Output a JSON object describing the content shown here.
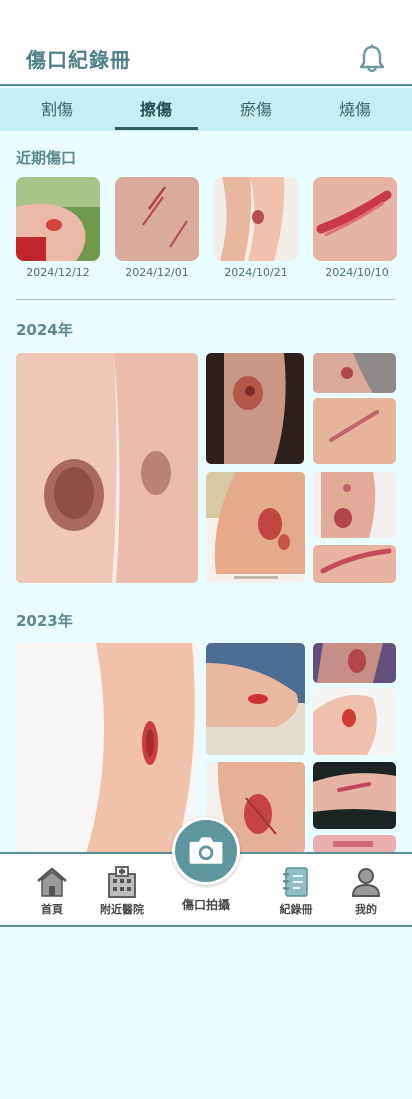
{
  "header": {
    "title": "傷口紀錄冊",
    "bell_icon": "bell-icon"
  },
  "tabs": [
    {
      "label": "割傷",
      "active": false
    },
    {
      "label": "擦傷",
      "active": true
    },
    {
      "label": "瘀傷",
      "active": false
    },
    {
      "label": "燒傷",
      "active": false
    }
  ],
  "recent": {
    "title": "近期傷口",
    "items": [
      {
        "date": "2024/12/12",
        "subject": "scraped elbow"
      },
      {
        "date": "2024/12/01",
        "subject": "scratches on skin"
      },
      {
        "date": "2024/10/21",
        "subject": "scraped knee"
      },
      {
        "date": "2024/10/10",
        "subject": "long abrasion"
      }
    ]
  },
  "years": [
    {
      "label": "2024年"
    },
    {
      "label": "2023年"
    }
  ],
  "nav": {
    "home": "首頁",
    "hospital": "附近醫院",
    "camera": "傷口拍攝",
    "records": "紀錄冊",
    "profile": "我的"
  },
  "colors": {
    "accent": "#5d979d",
    "background": "#e9fdfe",
    "tab_bar": "#c6eff4"
  }
}
